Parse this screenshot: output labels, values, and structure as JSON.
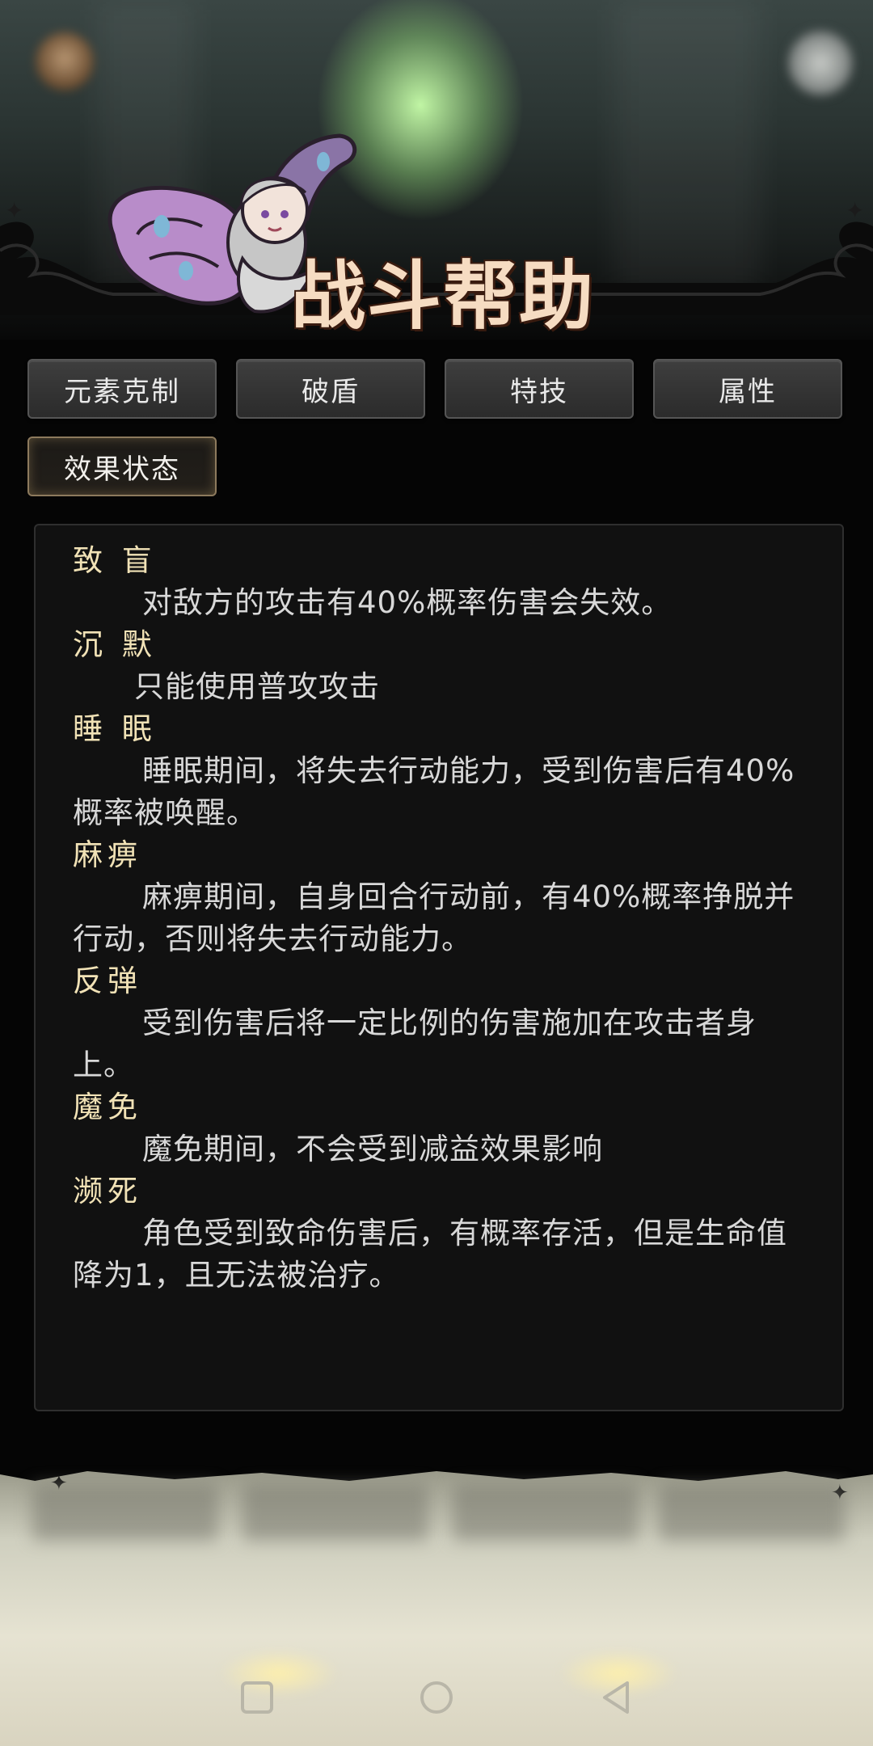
{
  "header": {
    "title": "战斗帮助"
  },
  "tabs": [
    {
      "label": "元素克制",
      "active": false
    },
    {
      "label": "破盾",
      "active": false
    },
    {
      "label": "特技",
      "active": false
    },
    {
      "label": "属性",
      "active": false
    },
    {
      "label": "效果状态",
      "active": true
    }
  ],
  "entries": [
    {
      "title": "致 盲",
      "desc": "对敌方的攻击有40%概率伤害会失效。"
    },
    {
      "title": "沉 默",
      "desc": "只能使用普攻攻击"
    },
    {
      "title": "睡 眠",
      "desc": "睡眠期间，将失去行动能力，受到伤害后有40%概率被唤醒。"
    },
    {
      "title": "麻痹",
      "desc": "麻痹期间，自身回合行动前，有40%概率挣脱并行动，否则将失去行动能力。"
    },
    {
      "title": "反弹",
      "desc": "受到伤害后将一定比例的伤害施加在攻击者身上。"
    },
    {
      "title": "魔免",
      "desc": "魔免期间，不会受到减益效果影响"
    },
    {
      "title": "濒死",
      "desc": "角色受到致命伤害后，有概率存活，但是生命值降为1，且无法被治疗。"
    }
  ],
  "colors": {
    "title_text": "#f6dcc2",
    "entry_title": "#f1e2b6",
    "entry_desc": "#d8d8d8",
    "active_tab_border": "#8d7a5d"
  },
  "icons": {
    "coin": "coin-icon",
    "profile": "profile-icon",
    "fairy": "fairy-mascot-icon",
    "nav_home": "square-icon",
    "nav_circle": "circle-icon",
    "nav_back": "triangle-back-icon"
  }
}
